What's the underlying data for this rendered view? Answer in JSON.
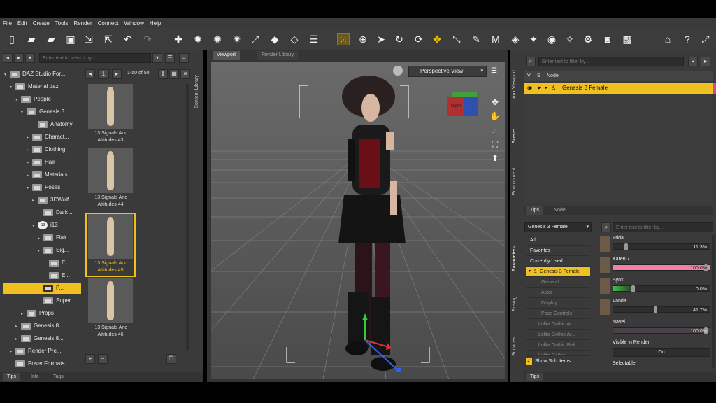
{
  "menu": [
    "File",
    "Edit",
    "Create",
    "Tools",
    "Render",
    "Connect",
    "Window",
    "Help"
  ],
  "left": {
    "search_placeholder": "Enter text to search by...",
    "tree": [
      {
        "label": "DAZ Studio For..."
      },
      {
        "label": "Material daz"
      },
      {
        "label": "People"
      },
      {
        "label": "Genesis 3..."
      },
      {
        "label": "Anatomy"
      },
      {
        "label": "Charact..."
      },
      {
        "label": "Clothing"
      },
      {
        "label": "Hair"
      },
      {
        "label": "Materials"
      },
      {
        "label": "Poses"
      },
      {
        "label": "3DWolf"
      },
      {
        "label": "Dark ..."
      },
      {
        "label": "i13"
      },
      {
        "label": "Flair"
      },
      {
        "label": "Sig..."
      },
      {
        "label": "E..."
      },
      {
        "label": "E..."
      },
      {
        "label": "P..."
      },
      {
        "label": "Super..."
      },
      {
        "label": "Props"
      },
      {
        "label": "Genesis 8"
      },
      {
        "label": "Genesis 8..."
      },
      {
        "label": "Render Pre..."
      },
      {
        "label": "Poser Formats"
      }
    ],
    "i13_badge": "i13",
    "pager": {
      "page": "1",
      "range": "1-50 of 50"
    },
    "thumbs": [
      {
        "caption": "i13 Signals And Attitudes 43"
      },
      {
        "caption": "i13 Signals And Attitudes 44"
      },
      {
        "caption": "i13 Signals And Attitudes 45"
      },
      {
        "caption": "i13 Signals And Attitudes 46"
      }
    ],
    "side_tab": "Content Library",
    "bottom_tabs": [
      "Tips",
      "Info",
      "Tags"
    ]
  },
  "viewport": {
    "tabs": [
      "Viewport",
      "Render Library"
    ],
    "camera": "Perspective View",
    "cube_label": "Right"
  },
  "scene": {
    "filter_placeholder": "Enter text to filter by...",
    "col_v": "V",
    "col_s": "S",
    "col_node": "Node",
    "node": "Genesis 3 Female",
    "side_tabs": [
      "Aux Viewport",
      "Scene",
      "Environment"
    ],
    "bottom_tabs": [
      "Tips",
      "Node"
    ]
  },
  "params": {
    "selector": "Genesis 3 Female",
    "filter_placeholder": "Enter text to filter by...",
    "list": [
      "All",
      "Favorites",
      "Currently Used",
      "Genesis 3 Female",
      "General",
      "Actor",
      "Display",
      "Pose Controls",
      "Lolita Gothic Ar...",
      "Lolita Gothic Ar...",
      "Lolita Gothic Belt",
      "Lolita Gothic..."
    ],
    "show_sub": "Show Sub Items",
    "sliders": [
      {
        "name": "Frida",
        "value": "11.3%",
        "level": 0.113
      },
      {
        "name": "Karen 7",
        "value": "100.0%",
        "level": 1.0
      },
      {
        "name": "Synx",
        "value": "0.0%",
        "level": 0.0
      },
      {
        "name": "Vanda",
        "value": "41.7%",
        "level": 0.417
      },
      {
        "name": "Navel",
        "value": "100.0%",
        "level": 1.0
      }
    ],
    "visible_label": "Visible in Render",
    "visible_value": "On",
    "selectable_label": "Selectable",
    "side_tabs": [
      "Parameters",
      "Posing",
      "Surfaces"
    ],
    "bottom_tab": "Tips"
  },
  "colors": {
    "accent": "#f0c020",
    "pink": "#f080a8",
    "green": "#40c040"
  }
}
